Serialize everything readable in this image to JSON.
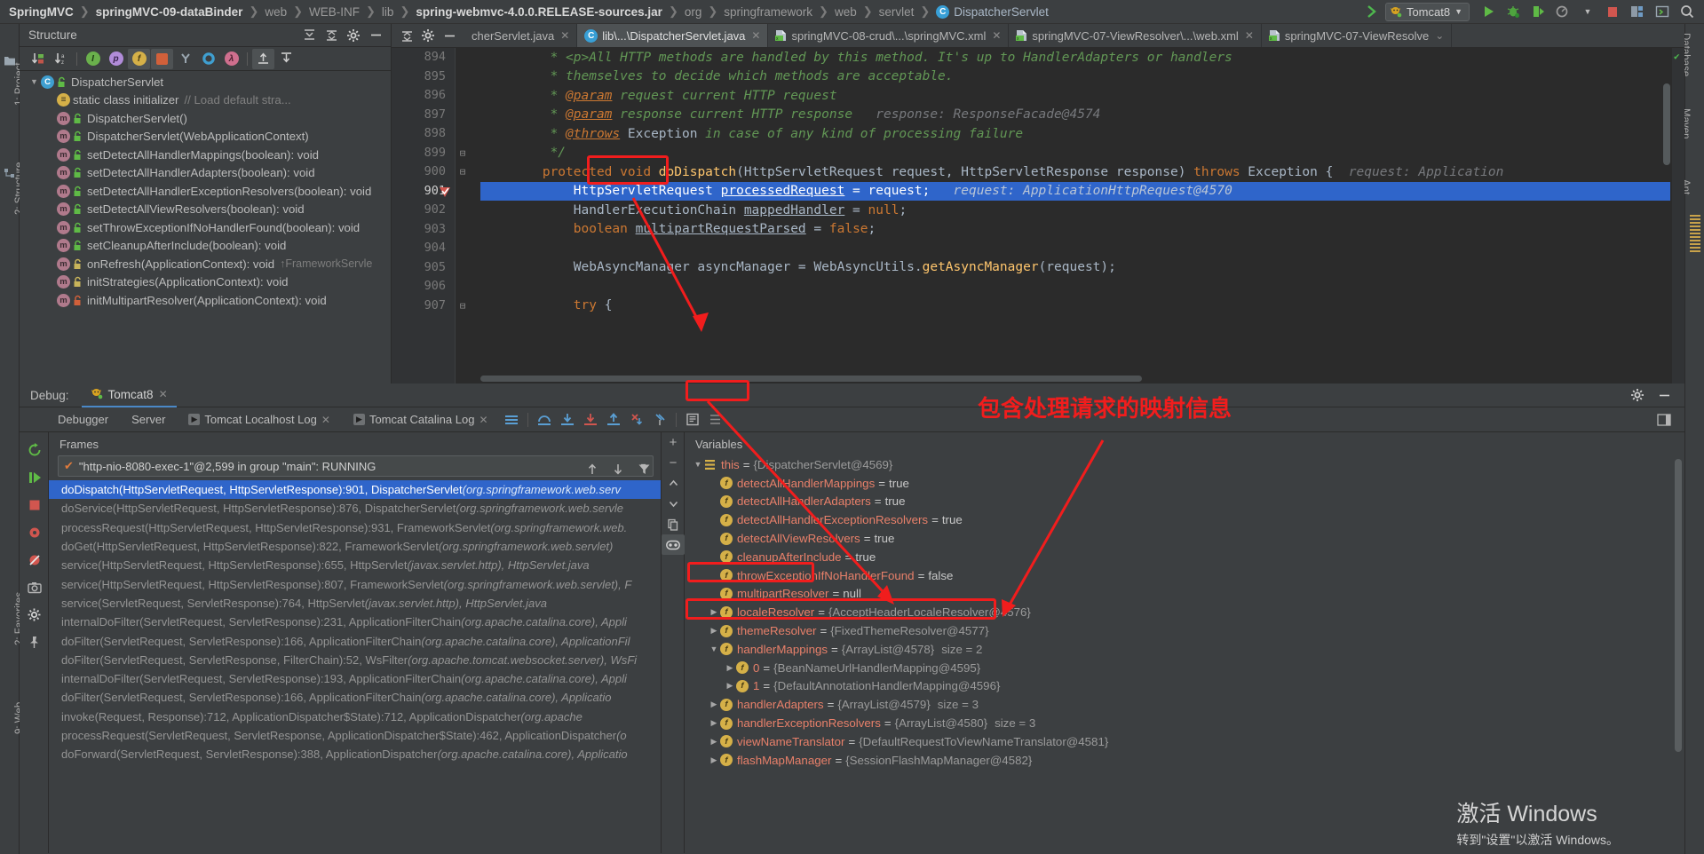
{
  "breadcrumb": [
    {
      "label": "SpringMVC",
      "style": "bold"
    },
    {
      "label": "springMVC-09-dataBinder",
      "style": "bold"
    },
    {
      "label": "web",
      "style": "dim"
    },
    {
      "label": "WEB-INF",
      "style": "dim"
    },
    {
      "label": "lib",
      "style": "dim"
    },
    {
      "label": "spring-webmvc-4.0.0.RELEASE-sources.jar",
      "style": "bold"
    },
    {
      "label": "org",
      "style": "dim"
    },
    {
      "label": "springframework",
      "style": "dim"
    },
    {
      "label": "web",
      "style": "dim"
    },
    {
      "label": "servlet",
      "style": "dim"
    },
    {
      "label": "DispatcherServlet",
      "style": "class"
    }
  ],
  "toolbar": {
    "run_config": "Tomcat8",
    "buttons": [
      "run-button",
      "debug-button",
      "run-with-coverage-button",
      "profile-button",
      "stop-button",
      "build-button",
      "console-button",
      "search-everywhere-button"
    ]
  },
  "left_rail": [
    "1: Project",
    "2: Structure",
    "2: Favorites",
    "9: Web"
  ],
  "right_rail": [
    "Database",
    "Maven",
    "Ant"
  ],
  "structure": {
    "title": "Structure",
    "tree": [
      {
        "label": "DispatcherServlet",
        "icon": "class",
        "indent": 0,
        "expanded": true
      },
      {
        "label": "static class initializer",
        "icon": "init",
        "indent": 1,
        "comment": "// Load default stra..."
      },
      {
        "label": "DispatcherServlet()",
        "icon": "method",
        "indent": 1
      },
      {
        "label": "DispatcherServlet(WebApplicationContext)",
        "icon": "method",
        "indent": 1
      },
      {
        "label": "setDetectAllHandlerMappings(boolean): void",
        "icon": "method",
        "indent": 1
      },
      {
        "label": "setDetectAllHandlerAdapters(boolean): void",
        "icon": "method",
        "indent": 1
      },
      {
        "label": "setDetectAllHandlerExceptionResolvers(boolean): void",
        "icon": "method",
        "indent": 1
      },
      {
        "label": "setDetectAllViewResolvers(boolean): void",
        "icon": "method",
        "indent": 1
      },
      {
        "label": "setThrowExceptionIfNoHandlerFound(boolean): void",
        "icon": "method",
        "indent": 1
      },
      {
        "label": "setCleanupAfterInclude(boolean): void",
        "icon": "method",
        "indent": 1
      },
      {
        "label": "onRefresh(ApplicationContext): void",
        "icon": "method-prot",
        "indent": 1,
        "inherit": "↑FrameworkServle"
      },
      {
        "label": "initStrategies(ApplicationContext): void",
        "icon": "method-prot",
        "indent": 1
      },
      {
        "label": "initMultipartResolver(ApplicationContext): void",
        "icon": "method-priv",
        "indent": 1
      }
    ]
  },
  "editor": {
    "tabs": [
      {
        "label": "cherServlet.java",
        "icon": "none",
        "active": false,
        "closable": true
      },
      {
        "label": "lib\\...\\DispatcherServlet.java",
        "icon": "class",
        "active": true,
        "closable": true
      },
      {
        "label": "springMVC-08-crud\\...\\springMVC.xml",
        "icon": "xml",
        "active": false,
        "closable": true
      },
      {
        "label": "springMVC-07-ViewResolver\\...\\web.xml",
        "icon": "xml",
        "active": false,
        "closable": true
      },
      {
        "label": "springMVC-07-ViewResolve",
        "icon": "xml",
        "active": false,
        "closable": false
      }
    ],
    "lines": [
      {
        "num": "894",
        "segments": [
          {
            "t": "         * <p>All HTTP methods are handled by this method. It's up to HandlerAdapters or handlers",
            "c": "cmt"
          }
        ]
      },
      {
        "num": "895",
        "segments": [
          {
            "t": "         * themselves to decide which methods are acceptable.",
            "c": "cmt"
          }
        ]
      },
      {
        "num": "896",
        "segments": [
          {
            "t": "         * ",
            "c": "cmt"
          },
          {
            "t": "@param",
            "c": "ptag"
          },
          {
            "t": " request current HTTP request",
            "c": "cmt"
          }
        ]
      },
      {
        "num": "897",
        "segments": [
          {
            "t": "         * ",
            "c": "cmt"
          },
          {
            "t": "@param",
            "c": "ptag"
          },
          {
            "t": " response current HTTP response",
            "c": "cmt"
          },
          {
            "t": "   response: ResponseFacade@4574",
            "c": "hint"
          }
        ]
      },
      {
        "num": "898",
        "segments": [
          {
            "t": "         * ",
            "c": "cmt"
          },
          {
            "t": "@throws",
            "c": "ptag"
          },
          {
            "t": " ",
            "c": "cmt"
          },
          {
            "t": "Exception",
            "c": "exc"
          },
          {
            "t": " in case of any kind of processing failure",
            "c": "cmt"
          }
        ]
      },
      {
        "num": "899",
        "segments": [
          {
            "t": "         */",
            "c": "cmt"
          }
        ],
        "fold": "−"
      },
      {
        "num": "900",
        "segments": [
          {
            "t": "        ",
            "c": "typ"
          },
          {
            "t": "protected void ",
            "c": "kw"
          },
          {
            "t": "doDispatch",
            "c": "mth"
          },
          {
            "t": "(HttpServletRequest request, HttpServletResponse response) ",
            "c": "typ"
          },
          {
            "t": "throws ",
            "c": "kw"
          },
          {
            "t": "Exception {",
            "c": "typ"
          },
          {
            "t": "  request: Application",
            "c": "hint"
          }
        ],
        "fold": "−"
      },
      {
        "num": "901",
        "segments": [
          {
            "t": "            HttpServletRequest ",
            "c": "typ"
          },
          {
            "t": "processedRequest",
            "c": "fld"
          },
          {
            "t": " = request;",
            "c": "typ"
          },
          {
            "t": "   request: ApplicationHttpRequest@4570",
            "c": "hint-hl"
          }
        ],
        "highlight": true,
        "breakpoint": true
      },
      {
        "num": "902",
        "segments": [
          {
            "t": "            HandlerExecutionChain ",
            "c": "typ"
          },
          {
            "t": "mappedHandler",
            "c": "fld"
          },
          {
            "t": " = ",
            "c": "typ"
          },
          {
            "t": "null",
            "c": "kw"
          },
          {
            "t": ";",
            "c": "typ"
          }
        ]
      },
      {
        "num": "903",
        "segments": [
          {
            "t": "            ",
            "c": "typ"
          },
          {
            "t": "boolean ",
            "c": "kw"
          },
          {
            "t": "multipartRequestParsed",
            "c": "fld"
          },
          {
            "t": " = ",
            "c": "typ"
          },
          {
            "t": "false",
            "c": "kw"
          },
          {
            "t": ";",
            "c": "typ"
          }
        ]
      },
      {
        "num": "904",
        "segments": [
          {
            "t": "",
            "c": "typ"
          }
        ]
      },
      {
        "num": "905",
        "segments": [
          {
            "t": "            WebAsyncManager asyncManager = WebAsyncUtils.",
            "c": "typ"
          },
          {
            "t": "getAsyncManager",
            "c": "mth"
          },
          {
            "t": "(request);",
            "c": "typ"
          }
        ]
      },
      {
        "num": "906",
        "segments": [
          {
            "t": "",
            "c": "typ"
          }
        ]
      },
      {
        "num": "907",
        "segments": [
          {
            "t": "            ",
            "c": "typ"
          },
          {
            "t": "try ",
            "c": "kw"
          },
          {
            "t": "{",
            "c": "typ"
          }
        ],
        "fold": "−"
      }
    ]
  },
  "debug": {
    "label": "Debug:",
    "session_tab": "Tomcat8",
    "subtabs": [
      {
        "label": "Debugger",
        "icon": "none",
        "closable": false
      },
      {
        "label": "Server",
        "icon": "none",
        "closable": false
      },
      {
        "label": "Tomcat Localhost Log",
        "icon": "console",
        "closable": true
      },
      {
        "label": "Tomcat Catalina Log",
        "icon": "console",
        "closable": true
      }
    ],
    "frames_title": "Frames",
    "thread": "\"http-nio-8080-exec-1\"@2,599 in group \"main\": RUNNING",
    "frames": [
      {
        "text": "doDispatch(HttpServletRequest, HttpServletResponse):901, DispatcherServlet ",
        "pkg": "(org.springframework.web.serv",
        "selected": true
      },
      {
        "text": "doService(HttpServletRequest, HttpServletResponse):876, DispatcherServlet ",
        "pkg": "(org.springframework.web.servle",
        "selected": false
      },
      {
        "text": "processRequest(HttpServletRequest, HttpServletResponse):931, FrameworkServlet ",
        "pkg": "(org.springframework.web.",
        "selected": false
      },
      {
        "text": "doGet(HttpServletRequest, HttpServletResponse):822, FrameworkServlet ",
        "pkg": "(org.springframework.web.servlet)",
        "selected": false
      },
      {
        "text": "service(HttpServletRequest, HttpServletResponse):655, HttpServlet ",
        "pkg": "(javax.servlet.http), HttpServlet.java",
        "selected": false
      },
      {
        "text": "service(HttpServletRequest, HttpServletResponse):807, FrameworkServlet ",
        "pkg": "(org.springframework.web.servlet), F",
        "selected": false
      },
      {
        "text": "service(ServletRequest, ServletResponse):764, HttpServlet ",
        "pkg": "(javax.servlet.http), HttpServlet.java",
        "selected": false
      },
      {
        "text": "internalDoFilter(ServletRequest, ServletResponse):231, ApplicationFilterChain ",
        "pkg": "(org.apache.catalina.core), Appli",
        "selected": false
      },
      {
        "text": "doFilter(ServletRequest, ServletResponse):166, ApplicationFilterChain ",
        "pkg": "(org.apache.catalina.core), ApplicationFil",
        "selected": false
      },
      {
        "text": "doFilter(ServletRequest, ServletResponse, FilterChain):52, WsFilter ",
        "pkg": "(org.apache.tomcat.websocket.server), WsFi",
        "selected": false
      },
      {
        "text": "internalDoFilter(ServletRequest, ServletResponse):193, ApplicationFilterChain ",
        "pkg": "(org.apache.catalina.core), Appli",
        "selected": false
      },
      {
        "text": "doFilter(ServletRequest, ServletResponse):166, ApplicationFilterChain ",
        "pkg": "(org.apache.catalina.core), Applicatio",
        "selected": false
      },
      {
        "text": "invoke(Request, Response):712, ApplicationDispatcher$State):712, ApplicationDispatcher ",
        "pkg": "(org.apache",
        "selected": false
      },
      {
        "text": "processRequest(ServletRequest, ServletResponse, ApplicationDispatcher$State):462, ApplicationDispatcher ",
        "pkg": "(o",
        "selected": false
      },
      {
        "text": "doForward(ServletRequest, ServletResponse):388, ApplicationDispatcher ",
        "pkg": "(org.apache.catalina.core), Applicatio",
        "selected": false
      }
    ],
    "variables_title": "Variables",
    "variables": [
      {
        "name": "this",
        "value": "{DispatcherServlet@4569}",
        "indent": 0,
        "icon": "this",
        "expandable": true,
        "expanded": true,
        "boxed": true
      },
      {
        "name": "detectAllHandlerMappings",
        "value": "true",
        "indent": 1,
        "icon": "field",
        "bool": true
      },
      {
        "name": "detectAllHandlerAdapters",
        "value": "true",
        "indent": 1,
        "icon": "field",
        "bool": true
      },
      {
        "name": "detectAllHandlerExceptionResolvers",
        "value": "true",
        "indent": 1,
        "icon": "field",
        "bool": true
      },
      {
        "name": "detectAllViewResolvers",
        "value": "true",
        "indent": 1,
        "icon": "field",
        "bool": true
      },
      {
        "name": "cleanupAfterInclude",
        "value": "true",
        "indent": 1,
        "icon": "field",
        "bool": true
      },
      {
        "name": "throwExceptionIfNoHandlerFound",
        "value": "false",
        "indent": 1,
        "icon": "field",
        "bool": true
      },
      {
        "name": "multipartResolver",
        "value": "null",
        "indent": 1,
        "icon": "field",
        "bool": true
      },
      {
        "name": "localeResolver",
        "value": "{AcceptHeaderLocaleResolver@4576}",
        "indent": 1,
        "icon": "field",
        "expandable": true
      },
      {
        "name": "themeResolver",
        "value": "{FixedThemeResolver@4577}",
        "indent": 1,
        "icon": "field",
        "expandable": true
      },
      {
        "name": "handlerMappings",
        "value": "{ArrayList@4578}",
        "size": "size = 2",
        "indent": 1,
        "icon": "field",
        "expandable": true,
        "expanded": true,
        "boxed": true
      },
      {
        "name": "0",
        "value": "{BeanNameUrlHandlerMapping@4595}",
        "indent": 2,
        "icon": "field",
        "expandable": true,
        "index": true
      },
      {
        "name": "1",
        "value": "{DefaultAnnotationHandlerMapping@4596}",
        "indent": 2,
        "icon": "field",
        "expandable": true,
        "index": true,
        "boxed": true
      },
      {
        "name": "handlerAdapters",
        "value": "{ArrayList@4579}",
        "size": "size = 3",
        "indent": 1,
        "icon": "field",
        "expandable": true
      },
      {
        "name": "handlerExceptionResolvers",
        "value": "{ArrayList@4580}",
        "size": "size = 3",
        "indent": 1,
        "icon": "field",
        "expandable": true
      },
      {
        "name": "viewNameTranslator",
        "value": "{DefaultRequestToViewNameTranslator@4581}",
        "indent": 1,
        "icon": "field",
        "expandable": true
      },
      {
        "name": "flashMapManager",
        "value": "{SessionFlashMapManager@4582}",
        "indent": 1,
        "icon": "field",
        "expandable": true
      }
    ]
  },
  "annotations": {
    "note_text": "包含处理请求的映射信息",
    "accent_color": "#f11d1d"
  },
  "watermark": {
    "line1": "激活 Windows",
    "line2": "转到\"设置\"以激活 Windows。"
  }
}
